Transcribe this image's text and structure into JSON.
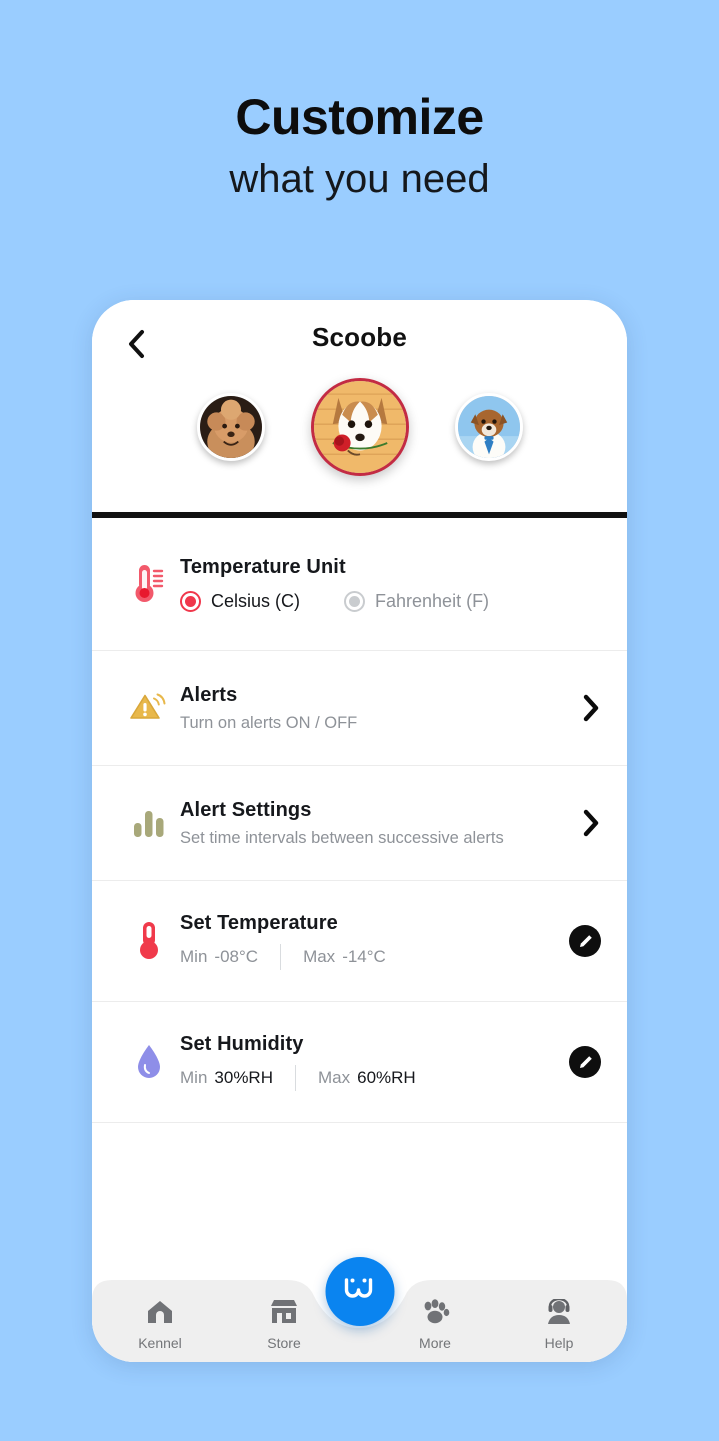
{
  "promo": {
    "title": "Customize",
    "subtitle": "what you need"
  },
  "app": {
    "header": {
      "back_icon": "chevron-left-icon",
      "title": "Scoobe",
      "avatars": [
        {
          "name": "dog-avatar-poodle",
          "selected": false
        },
        {
          "name": "dog-avatar-jack-russell-rose",
          "selected": true
        },
        {
          "name": "dog-avatar-terrier-tie",
          "selected": false
        }
      ]
    },
    "settings": [
      {
        "key": "temperature-unit",
        "icon": "thermometer-icon",
        "title": "Temperature Unit",
        "options": [
          {
            "label": "Celsius (C)",
            "selected": true
          },
          {
            "label": "Fahrenheit (F)",
            "selected": false
          }
        ]
      },
      {
        "key": "alerts",
        "icon": "alert-triangle-icon",
        "title": "Alerts",
        "subtitle": "Turn on alerts ON / OFF",
        "trailing": "chevron-right-icon"
      },
      {
        "key": "alert-settings",
        "icon": "bar-chart-icon",
        "title": "Alert Settings",
        "subtitle": "Set time intervals between successive alerts",
        "trailing": "chevron-right-icon"
      },
      {
        "key": "set-temperature",
        "icon": "thermometer-filled-icon",
        "title": "Set Temperature",
        "min_label": "Min",
        "min_value": "-08°C",
        "max_label": "Max",
        "max_value": "-14°C",
        "trailing": "edit-pencil-icon"
      },
      {
        "key": "set-humidity",
        "icon": "water-drop-icon",
        "title": "Set Humidity",
        "min_label": "Min",
        "min_value": "30%RH",
        "max_label": "Max",
        "max_value": "60%RH",
        "trailing": "edit-pencil-icon"
      }
    ],
    "bottom_nav": {
      "items": [
        {
          "icon": "home-icon",
          "label": "Kennel"
        },
        {
          "icon": "store-icon",
          "label": "Store"
        },
        {
          "icon": "paw-icon",
          "label": "More"
        },
        {
          "icon": "support-agent-icon",
          "label": "Help"
        }
      ],
      "fab": {
        "icon": "brand-w-logo-icon"
      }
    }
  },
  "colors": {
    "page_background": "#9ACDFF",
    "accent_blue": "#0A84F0",
    "selected_ring": "#C32B43",
    "radio_active": "#F0374B",
    "thermometer": "#F2596B",
    "thermometer_solid": "#F03A4B",
    "alert_triangle": "#E8B84B",
    "bar_chart": "#A8A87A",
    "water_drop": "#8E8EE8",
    "nav_bar": "#EFEFEF"
  }
}
